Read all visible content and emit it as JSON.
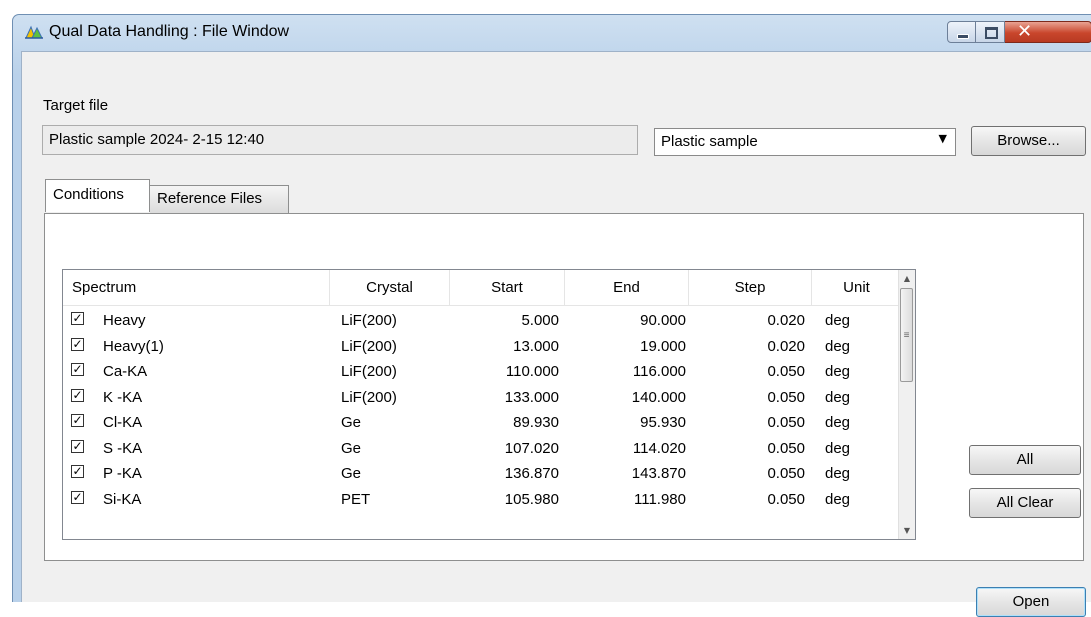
{
  "window": {
    "title": "Qual Data Handling : File Window",
    "close_glyph": "✕"
  },
  "target": {
    "label": "Target file",
    "value": "Plastic sample 2024- 2-15 12:40",
    "combo_value": "Plastic sample",
    "browse_label": "Browse..."
  },
  "tabs": [
    {
      "label": "Conditions",
      "selected": true
    },
    {
      "label": "Reference Files",
      "selected": false
    }
  ],
  "table": {
    "columns": [
      "Spectrum",
      "Crystal",
      "Start",
      "End",
      "Step",
      "Unit"
    ],
    "rows": [
      {
        "checked": true,
        "spectrum": "Heavy",
        "crystal": "LiF(200)",
        "start": "5.000",
        "end": "90.000",
        "step": "0.020",
        "unit": "deg"
      },
      {
        "checked": true,
        "spectrum": "Heavy(1)",
        "crystal": "LiF(200)",
        "start": "13.000",
        "end": "19.000",
        "step": "0.020",
        "unit": "deg"
      },
      {
        "checked": true,
        "spectrum": "Ca-KA",
        "crystal": "LiF(200)",
        "start": "110.000",
        "end": "116.000",
        "step": "0.050",
        "unit": "deg"
      },
      {
        "checked": true,
        "spectrum": "K -KA",
        "crystal": "LiF(200)",
        "start": "133.000",
        "end": "140.000",
        "step": "0.050",
        "unit": "deg"
      },
      {
        "checked": true,
        "spectrum": "Cl-KA",
        "crystal": "Ge",
        "start": "89.930",
        "end": "95.930",
        "step": "0.050",
        "unit": "deg"
      },
      {
        "checked": true,
        "spectrum": "S -KA",
        "crystal": "Ge",
        "start": "107.020",
        "end": "114.020",
        "step": "0.050",
        "unit": "deg"
      },
      {
        "checked": true,
        "spectrum": "P -KA",
        "crystal": "Ge",
        "start": "136.870",
        "end": "143.870",
        "step": "0.050",
        "unit": "deg"
      },
      {
        "checked": true,
        "spectrum": "Si-KA",
        "crystal": "PET",
        "start": "105.980",
        "end": "111.980",
        "step": "0.050",
        "unit": "deg"
      }
    ]
  },
  "buttons": {
    "all": "All",
    "all_clear": "All Clear",
    "open": "Open"
  },
  "glyphs": {
    "check": "✓",
    "scroll_up": "▲",
    "scroll_down": "▼",
    "thumb_grip": "≡",
    "combo_arrow": "▼"
  }
}
